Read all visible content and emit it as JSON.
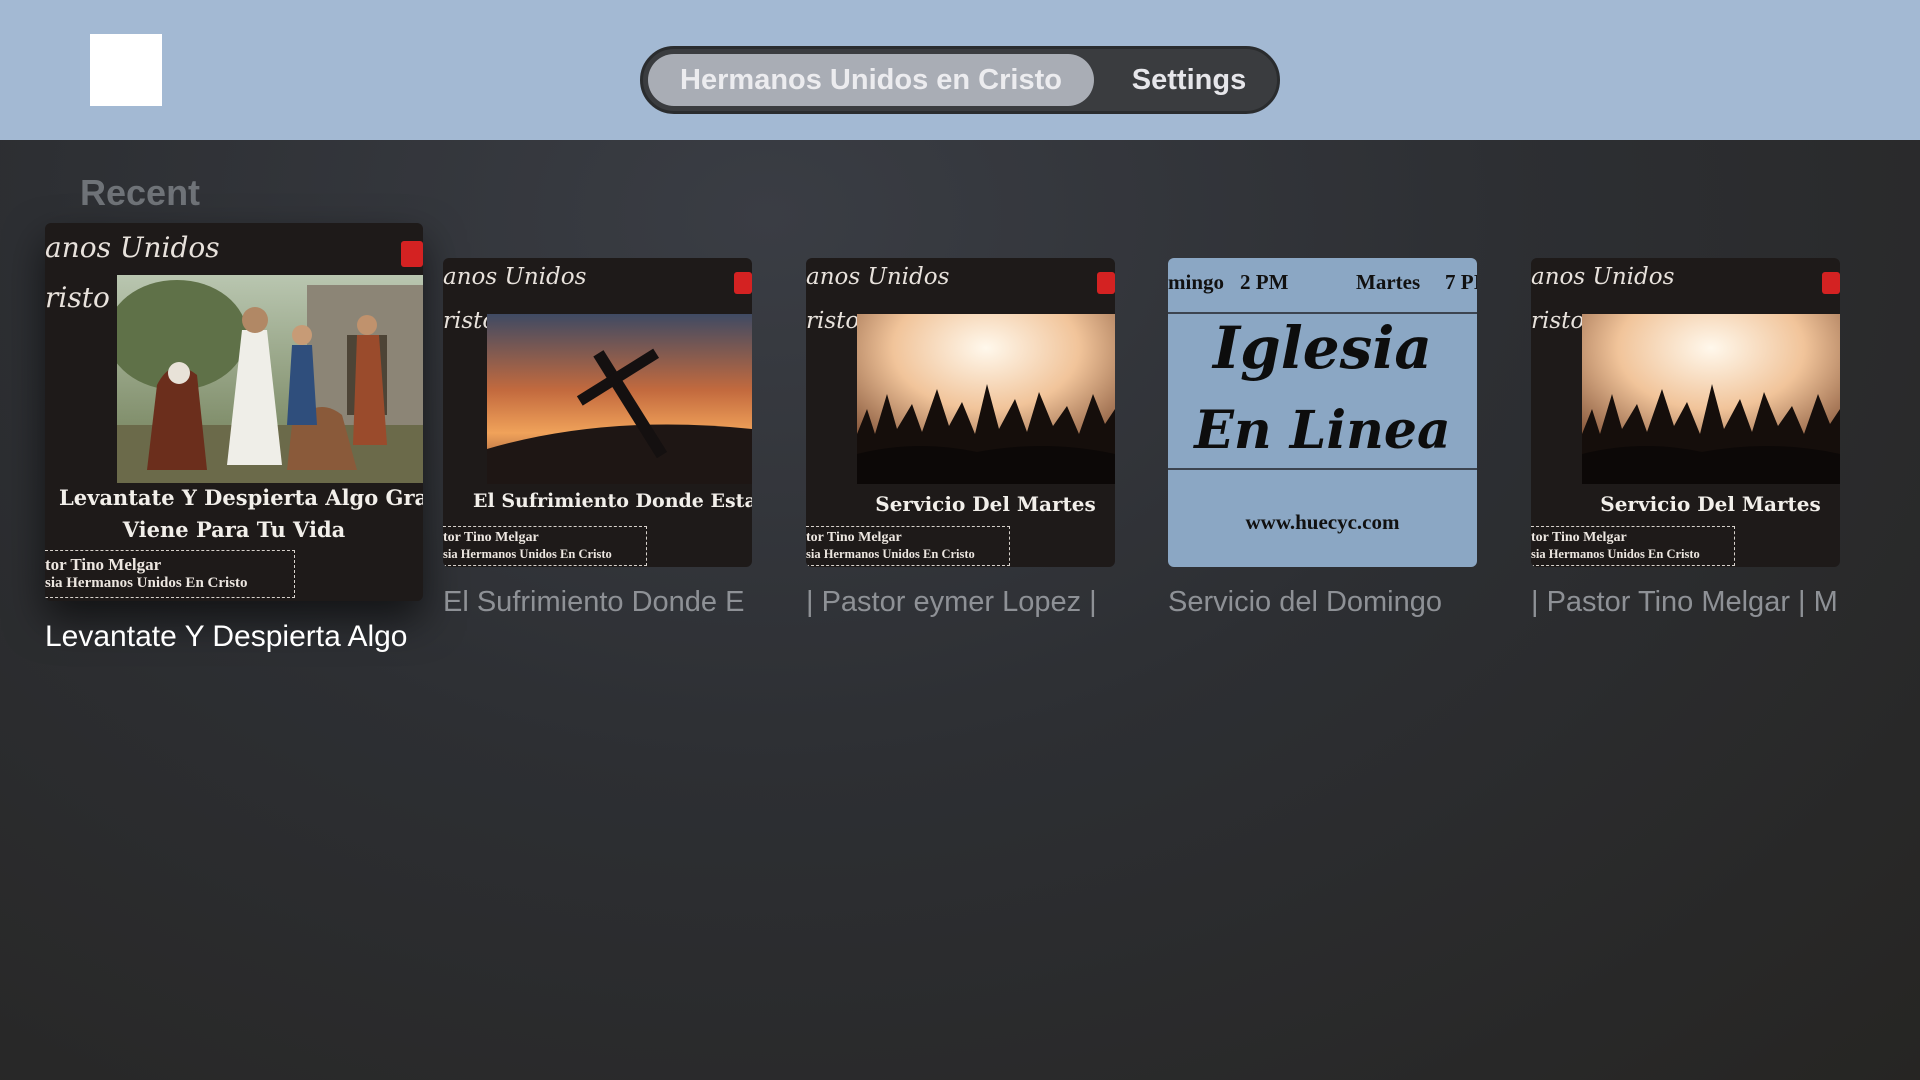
{
  "header": {
    "tabs": [
      {
        "label": "Hermanos Unidos en Cristo",
        "active": true
      },
      {
        "label": "Settings",
        "active": false
      }
    ]
  },
  "section": {
    "title": "Recent"
  },
  "items": [
    {
      "label": "Levantate Y Despierta Algo",
      "thumb": {
        "brand": "anos Unidos",
        "brand2": "risto",
        "title_line1": "Levantate Y Despierta Algo Grand",
        "title_line2": "Viene Para Tu Vida",
        "pastor_line1": "tor Tino Melgar",
        "pastor_line2": "sia Hermanos Unidos En Cristo"
      }
    },
    {
      "label": "El Sufrimiento Donde E",
      "thumb": {
        "brand": "anos Unidos",
        "brand2": "risto",
        "title_line1": "El Sufrimiento Donde Esta",
        "pastor_line1": "tor Tino Melgar",
        "pastor_line2": "sia Hermanos Unidos En Cristo"
      }
    },
    {
      "label": "| Pastor eymer Lopez |",
      "thumb": {
        "brand": "anos Unidos",
        "brand2": "risto",
        "title_line1": "Servicio Del Martes",
        "pastor_line1": "tor Tino Melgar",
        "pastor_line2": "sia Hermanos Unidos En Cristo"
      }
    },
    {
      "label": "Servicio del Domingo",
      "thumb": {
        "day1": "mingo",
        "time1": "2 PM",
        "day2": "Martes",
        "time2": "7 PI",
        "big1": "Iglesia",
        "big2": "En Linea",
        "url": "www.huecyc.com"
      }
    },
    {
      "label": "| Pastor Tino Melgar | M",
      "thumb": {
        "brand": "anos Unidos",
        "brand2": "risto",
        "title_line1": "Servicio Del Martes",
        "pastor_line1": "tor Tino Melgar",
        "pastor_line2": "sia Hermanos Unidos En Cristo"
      }
    }
  ],
  "colors": {
    "topbar": "#a3b9d3",
    "focused_label": "#ffffff",
    "unfocused_label": "#8e9196"
  }
}
